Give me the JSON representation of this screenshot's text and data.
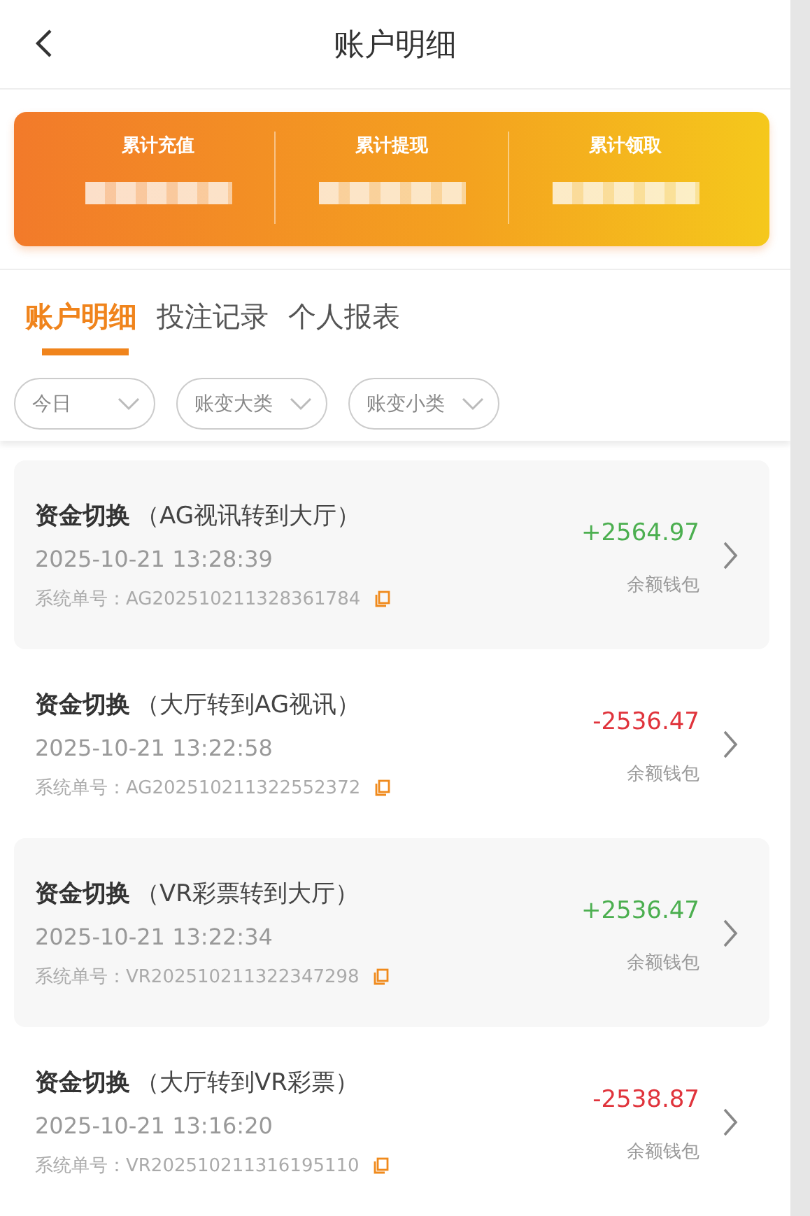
{
  "header": {
    "title": "账户明细"
  },
  "summary": [
    {
      "label": "累计充值"
    },
    {
      "label": "累计提现"
    },
    {
      "label": "累计领取"
    }
  ],
  "tabs": [
    {
      "label": "账户明细",
      "selected": true
    },
    {
      "label": "投注记录",
      "selected": false
    },
    {
      "label": "个人报表",
      "selected": false
    }
  ],
  "filters": [
    {
      "label": "今日"
    },
    {
      "label": "账变大类"
    },
    {
      "label": "账变小类"
    }
  ],
  "records": [
    {
      "type": "资金切换",
      "detail": "（AG视讯转到大厅）",
      "time": "2025-10-21 13:28:39",
      "order_label": "系统单号：",
      "order_no": "AG202510211328361784",
      "amount": "+2564.97",
      "kind": "credit",
      "wallet": "余额钱包"
    },
    {
      "type": "资金切换",
      "detail": "（大厅转到AG视讯）",
      "time": "2025-10-21 13:22:58",
      "order_label": "系统单号：",
      "order_no": "AG202510211322552372",
      "amount": "-2536.47",
      "kind": "debit",
      "wallet": "余额钱包"
    },
    {
      "type": "资金切换",
      "detail": "（VR彩票转到大厅）",
      "time": "2025-10-21 13:22:34",
      "order_label": "系统单号：",
      "order_no": "VR202510211322347298",
      "amount": "+2536.47",
      "kind": "credit",
      "wallet": "余额钱包"
    },
    {
      "type": "资金切换",
      "detail": "（大厅转到VR彩票）",
      "time": "2025-10-21 13:16:20",
      "order_label": "系统单号：",
      "order_no": "VR202510211316195110",
      "amount": "-2538.87",
      "kind": "debit",
      "wallet": "余额钱包"
    }
  ]
}
